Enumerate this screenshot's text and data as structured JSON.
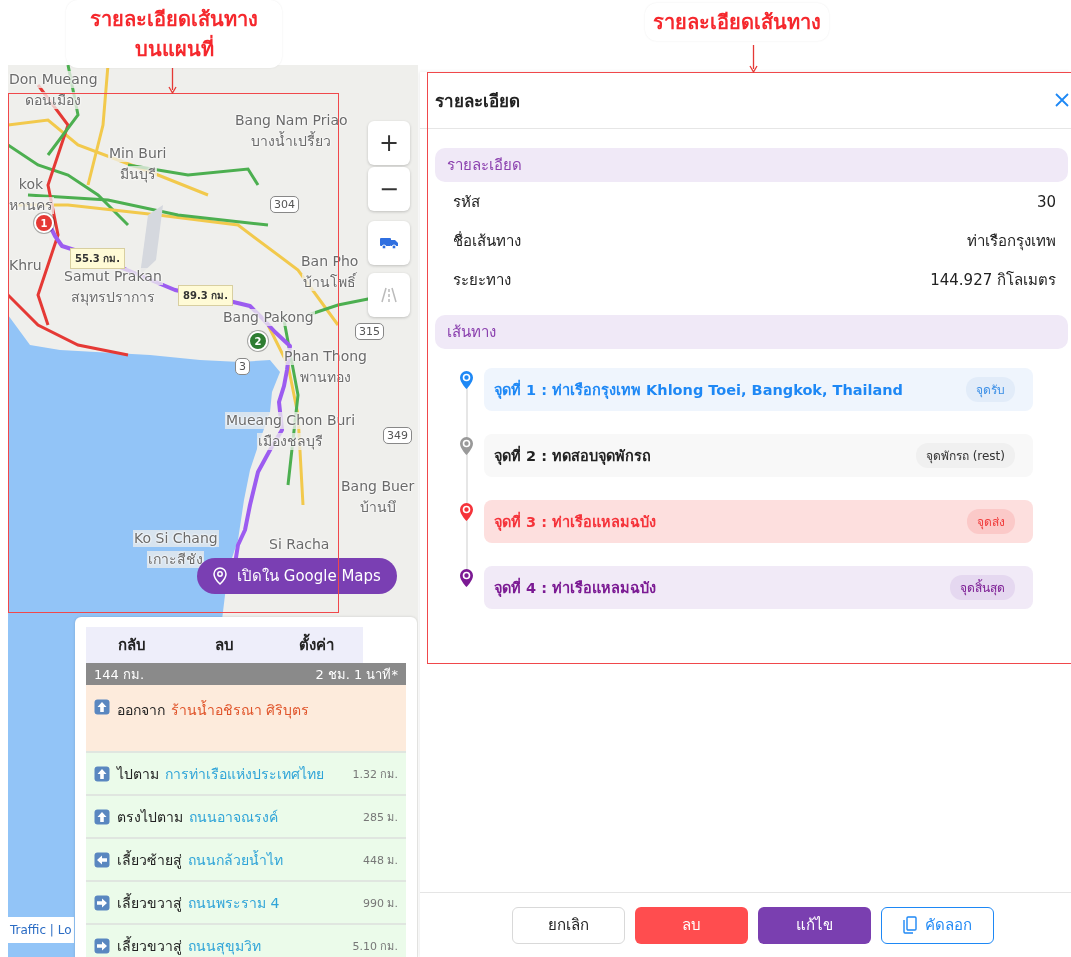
{
  "annotations": [
    {
      "text": "รายละเอียดเส้นทาง บนแผนที่"
    },
    {
      "text": "รายละเอียดเส้นทาง"
    }
  ],
  "map": {
    "places": [
      {
        "name": "Don Mueang",
        "local": "ดอนเมือง"
      },
      {
        "name": "Bang Nam Priao",
        "local": "บางน้ำเปรี้ยว"
      },
      {
        "name": "Min Buri",
        "local": "มีนบุรี"
      },
      {
        "name": "kok",
        "local": "หานคร"
      },
      {
        "name": "Khru"
      },
      {
        "name": "Samut Prakan",
        "local": "สมุทรปราการ"
      },
      {
        "name": "Ban Pho",
        "local": "บ้านโพธิ์"
      },
      {
        "name": "Bang Pakong"
      },
      {
        "name": "Phan Thong",
        "local": "พานทอง"
      },
      {
        "name": "Mueang Chon Buri",
        "local": "เมืองชลบุรี"
      },
      {
        "name": "Bang Buer",
        "local": "บ้านบึ"
      },
      {
        "name": "Ko Si Chang",
        "local": "เกาะสีชัง"
      },
      {
        "name": "Si Racha"
      }
    ],
    "road_numbers": [
      "304",
      "315",
      "3",
      "349"
    ],
    "route_labels": [
      "55.3 กม.",
      "89.3 กม."
    ],
    "markers": [
      {
        "number": "1",
        "color": "#e53935"
      },
      {
        "number": "2",
        "color": "#2e7d32"
      }
    ],
    "zoom_in": "+",
    "zoom_out": "−",
    "open_button": "เปิดใน Google Maps",
    "attribution": "Traffic | Lo"
  },
  "directions": {
    "buttons": [
      "กลับ",
      "ลบ",
      "ตั้งค่า"
    ],
    "summary": {
      "distance": "144 กม.",
      "duration": "2 ชม. 1 นาที*"
    },
    "steps": [
      {
        "kind": "start",
        "action": "ออกจาก",
        "place": "ร้านน้ำอชิรณา ศิริบุตร"
      },
      {
        "kind": "straight",
        "action": "ไปตาม",
        "place": "การท่าเรือแห่งประเทศไทย",
        "distance": "1.32 กม."
      },
      {
        "kind": "straight",
        "action": "ตรงไปตาม",
        "place": "ถนนอาจณรงค์",
        "distance": "285 ม."
      },
      {
        "kind": "left",
        "action": "เลี้ยวซ้ายสู่",
        "place": "ถนนกล้วยน้ำไท",
        "distance": "448 ม."
      },
      {
        "kind": "right",
        "action": "เลี้ยวขวาสู่",
        "place": "ถนนพระราม 4",
        "distance": "990 ม."
      },
      {
        "kind": "right",
        "action": "เลี้ยวขวาสู่",
        "place": "ถนนสุขุมวิท",
        "distance": "5.10 กม."
      }
    ]
  },
  "detail": {
    "title": "รายละเอียด",
    "info_heading": "รายละเอียด",
    "fields": [
      {
        "label": "รหัส",
        "value": "30"
      },
      {
        "label": "ชื่อเส้นทาง",
        "value": "ท่าเรือกรุงเทพ"
      },
      {
        "label": "ระยะทาง",
        "value": "144.927 กิโลเมตร"
      }
    ],
    "route_heading": "เส้นทาง",
    "stops": [
      {
        "kind": "pickup",
        "color": "#1e88f5",
        "label": "จุดที่ 1 : ท่าเรือกรุงเทพ Khlong Toei, Bangkok, Thailand",
        "tag": "จุดรับ"
      },
      {
        "kind": "rest",
        "color": "#999999",
        "label": "จุดที่ 2 : ทดสอบจุดพักรถ",
        "tag": "จุดพักรถ (rest)"
      },
      {
        "kind": "dropoff",
        "color": "#f5333a",
        "label": "จุดที่ 3 : ท่าเรือแหลมฉบัง",
        "tag": "จุดส่ง"
      },
      {
        "kind": "end",
        "color": "#7b1a93",
        "label": "จุดที่ 4 : ท่าเรือแหลมฉบัง",
        "tag": "จุดสิ้นสุด"
      }
    ],
    "buttons": [
      {
        "kind": "cancel",
        "label": "ยกเลิก"
      },
      {
        "kind": "delete",
        "label": "ลบ"
      },
      {
        "kind": "edit",
        "label": "แก้ไข"
      },
      {
        "kind": "copy",
        "label": "คัดลอก"
      }
    ]
  }
}
